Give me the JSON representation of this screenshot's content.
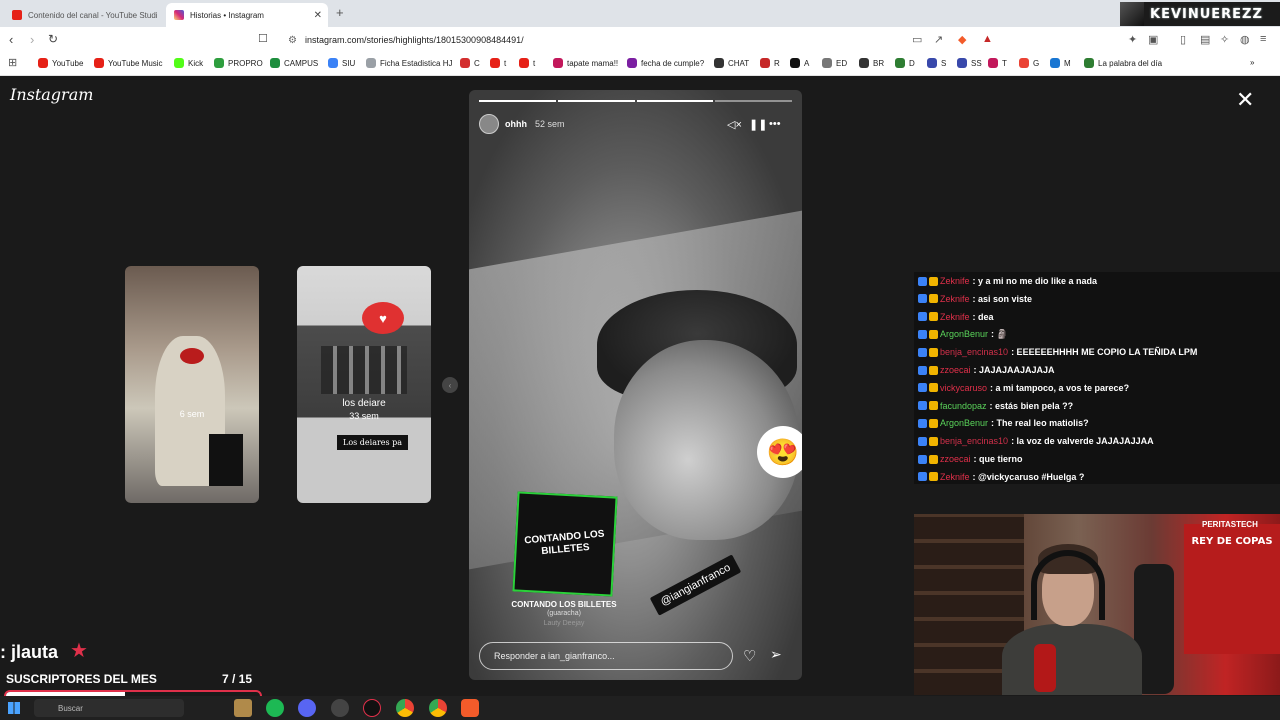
{
  "browser": {
    "tabs": [
      {
        "title": "Contenido del canal - YouTube Studi",
        "active": false,
        "color": "#e62117"
      },
      {
        "title": "Historias • Instagram",
        "active": true,
        "color": "#d62976"
      }
    ],
    "new_tab": "+",
    "url": "instagram.com/stories/highlights/18015300908484491/",
    "profile_name": "KEVINUEREZZ",
    "bookmarks": [
      {
        "label": "YouTube",
        "color": "#e62117"
      },
      {
        "label": "YouTube Music",
        "color": "#e62117"
      },
      {
        "label": "Kick",
        "color": "#53fc18"
      },
      {
        "label": "PROPRO",
        "color": "#2e9e3e"
      },
      {
        "label": "CAMPUS",
        "color": "#1e8e3e"
      },
      {
        "label": "SIU",
        "color": "#3b82f6"
      },
      {
        "label": "Ficha Estadistica HJ",
        "color": "#9aa0a6"
      },
      {
        "label": "C",
        "color": "#d32f2f"
      },
      {
        "label": "t",
        "color": "#e62117"
      },
      {
        "label": "t",
        "color": "#e62117"
      },
      {
        "label": "tapate mama!!",
        "color": "#c2185b"
      },
      {
        "label": "fecha de cumple?",
        "color": "#7b1fa2"
      },
      {
        "label": "CHAT",
        "color": "#333333"
      },
      {
        "label": "R",
        "color": "#c62828"
      },
      {
        "label": "A",
        "color": "#111111"
      },
      {
        "label": "ED",
        "color": "#777777"
      },
      {
        "label": "BR",
        "color": "#333333"
      },
      {
        "label": "D",
        "color": "#2e7d32"
      },
      {
        "label": "S",
        "color": "#3949ab"
      },
      {
        "label": "SS",
        "color": "#3949ab"
      },
      {
        "label": "T",
        "color": "#c2185b"
      },
      {
        "label": "G",
        "color": "#ea4335"
      },
      {
        "label": "M",
        "color": "#1976d2"
      },
      {
        "label": "La palabra del día",
        "color": "#2e7d32"
      }
    ]
  },
  "instagram": {
    "logo": "Instagram",
    "close": "✕",
    "previews": [
      {
        "label": "6 sem"
      },
      {
        "label": "los deiare",
        "time": "33 sem",
        "caption": "Los deiares pa"
      }
    ],
    "story": {
      "username": "ohhh",
      "time": "52 sem",
      "segments_total": 4,
      "segments_done": 3,
      "emoji": "😍",
      "music_card_text": "CONTANDO LOS BILLETES",
      "music_title": "CONTANDO LOS BILLETES",
      "music_sub": "(guaracha)",
      "music_artist": "Lauty Deejay",
      "mention": "@iangianfranco",
      "reply_placeholder": "Responder a ian_gianfranco..."
    }
  },
  "chat": {
    "messages": [
      {
        "user": "Zeknife",
        "color": "#e0304a",
        "text": ": y a mi no me dio like a nada"
      },
      {
        "user": "Zeknife",
        "color": "#e0304a",
        "text": ": asi son viste"
      },
      {
        "user": "Zeknife",
        "color": "#e0304a",
        "text": ": dea"
      },
      {
        "user": "ArgonBenur",
        "color": "#5ad35a",
        "text": ": 🗿"
      },
      {
        "user": "benja_encinas10",
        "color": "#d0304a",
        "text": ": EEEEEEHHHH ME COPIO LA TEÑIDA LPM"
      },
      {
        "user": "zzoecai",
        "color": "#e0304a",
        "text": ": JAJAJAAJAJAJA"
      },
      {
        "user": "vickycaruso",
        "color": "#e0304a",
        "text": ": a mi tampoco, a vos te parece?"
      },
      {
        "user": "facundopaz",
        "color": "#5ad35a",
        "text": ": estás bien pela ??"
      },
      {
        "user": "ArgonBenur",
        "color": "#5ad35a",
        "text": ": The real leo matiolis?"
      },
      {
        "user": "benja_encinas10",
        "color": "#d0304a",
        "text": ": la voz de valverde JAJAJAJJAA"
      },
      {
        "user": "zzoecai",
        "color": "#e0304a",
        "text": ": que tierno"
      },
      {
        "user": "Zeknife",
        "color": "#e0304a",
        "text": ": @vickycaruso #Huelga ?"
      }
    ]
  },
  "webcam": {
    "banner_title": "REY DE COPAS",
    "brand": "PERITASTECH"
  },
  "subs": {
    "name": ": jlauta",
    "star": "★",
    "title": "SUSCRIPTORES DEL MES",
    "count": "7  / 15",
    "progress": 0.47
  },
  "taskbar": {
    "search_placeholder": "Buscar"
  }
}
